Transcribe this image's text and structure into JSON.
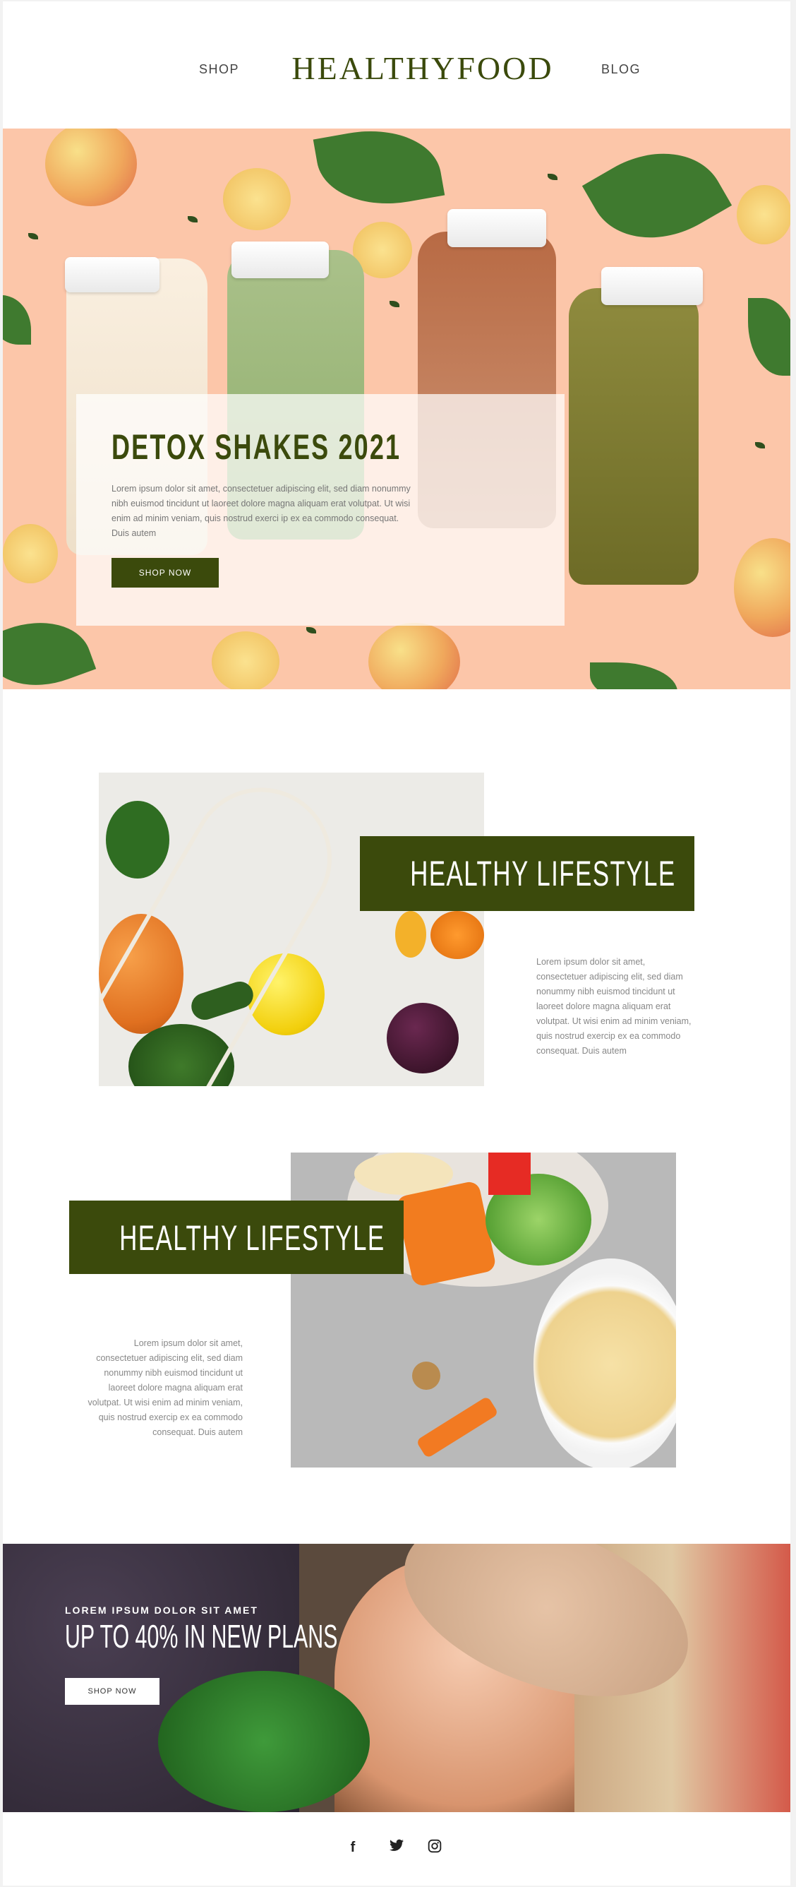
{
  "header": {
    "logo": "HEALTHYFOOD",
    "nav_left": "SHOP",
    "nav_right": "BLOG"
  },
  "hero": {
    "title": "DETOX SHAKES 2021",
    "text": "Lorem ipsum dolor sit amet, consectetuer adipiscing elit, sed diam nonummy nibh euismod tincidunt ut laoreet dolore magna aliquam erat volutpat. Ut wisi enim ad minim veniam, quis nostrud exerci ip ex ea commodo consequat. Duis autem",
    "button": "SHOP NOW"
  },
  "feature1": {
    "title": "HEALTHY LIFESTYLE",
    "text": "Lorem ipsum dolor sit amet, consectetuer adipiscing elit, sed diam nonummy nibh euismod tincidunt ut laoreet dolore magna aliquam erat volutpat. Ut wisi enim ad minim veniam, quis nostrud exercip ex ea commodo consequat. Duis autem"
  },
  "feature2": {
    "title": "HEALTHY LIFESTYLE",
    "text": "Lorem ipsum dolor sit amet, consectetuer adipiscing elit, sed diam nonummy nibh euismod tincidunt ut laoreet dolore magna aliquam erat volutpat. Ut wisi enim ad minim veniam, quis nostrud exercip ex ea commodo consequat. Duis autem"
  },
  "promo": {
    "kicker": "LOREM IPSUM DOLOR SIT AMET",
    "title": "UP TO 40% IN NEW PLANS",
    "button": "SHOP NOW"
  },
  "footer": {
    "social": [
      {
        "icon": "facebook-icon",
        "glyph": "f"
      },
      {
        "icon": "twitter-icon",
        "glyph": "🐦"
      },
      {
        "icon": "instagram-icon",
        "glyph": "◎"
      }
    ]
  },
  "colors": {
    "brand_green": "#3b4a0c",
    "hero_bg": "#fcc6a9",
    "text_gray": "#888888"
  }
}
